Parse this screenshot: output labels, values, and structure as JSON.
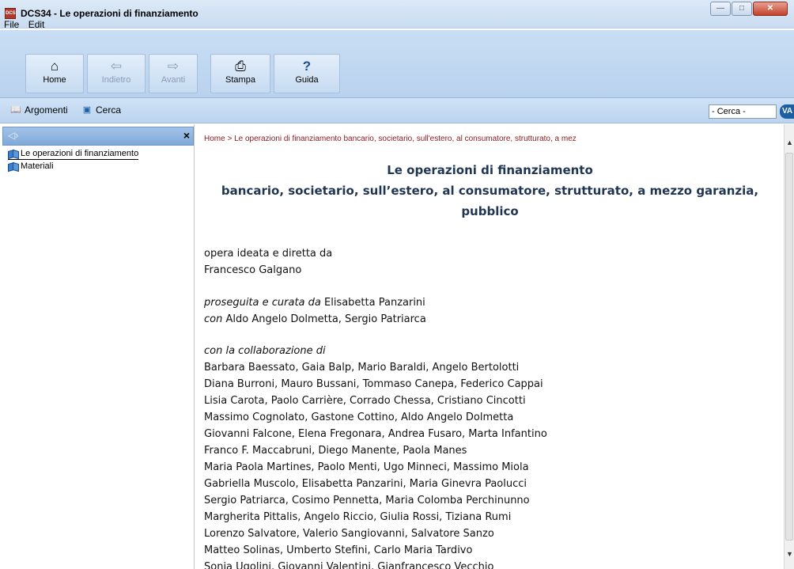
{
  "window": {
    "app_icon_text": "DCS",
    "title": "DCS34 - Le operazioni di finanziamento",
    "controls": [
      "minimize",
      "maximize",
      "close"
    ]
  },
  "menu": {
    "items": [
      "File",
      "Edit"
    ]
  },
  "toolbar": {
    "home": "Home",
    "back": "Indietro",
    "forward": "Avanti",
    "print": "Stampa",
    "help": "Guida"
  },
  "navbar": {
    "topics": "Argomenti",
    "search": "Cerca",
    "search_placeholder": "- Cerca -",
    "go": "VA"
  },
  "leftpane": {
    "tree": [
      {
        "label": "Le operazioni di finanziamento"
      },
      {
        "label": "Materiali"
      }
    ]
  },
  "content": {
    "breadcrumb": "Home > Le operazioni di finanziamento bancario, societario, sull'estero, al consumatore, strutturato, a mez",
    "title_line1": "Le operazioni di finanziamento",
    "title_line2": "bancario, societario, sull’estero, al consumatore, strutturato, a mezzo garanzia,",
    "title_line3": "pubblico",
    "intro_line1": "opera ideata e diretta da",
    "intro_line2": "Francesco Galgano",
    "continued_label": "proseguita e curata da",
    "continued_name": " Elisabetta Panzarini",
    "with_label": "con",
    "with_names": " Aldo Angelo Dolmetta, Sergio Patriarca",
    "collab_label": "con la collaborazione di",
    "collaborators": [
      "Barbara Baessato, Gaia Balp, Mario Baraldi, Angelo Bertolotti",
      "Diana Burroni, Mauro Bussani, Tommaso Canepa, Federico Cappai",
      "Lisia Carota, Paolo Carrière, Corrado Chessa, Cristiano Cincotti",
      "Massimo Cognolato, Gastone Cottino, Aldo Angelo Dolmetta",
      "Giovanni Falcone, Elena Fregonara, Andrea Fusaro, Marta Infantino",
      "Franco F. Maccabruni, Diego Manente, Paola Manes",
      "Maria Paola Martines, Paolo Menti, Ugo Minneci, Massimo Miola",
      "Gabriella Muscolo, Elisabetta Panzarini, Maria Ginevra Paolucci",
      "Sergio Patriarca, Cosimo Pennetta, Maria Colomba Perchinunno",
      "Margherita Pittalis, Angelo Riccio, Giulia Rossi, Tiziana Rumi",
      "Lorenzo Salvatore, Valerio Sangiovanni, Salvatore Sanzo",
      "Matteo Solinas, Umberto Stefini, Carlo Maria Tardivo",
      "Sonia Ugolini, Giovanni Valentini, Gianfrancesco Vecchio"
    ]
  },
  "colors": {
    "titlebar": "#c9dcf0",
    "toolbar": "#b9d2ee",
    "breadcrumb": "#8a1a1a",
    "title_text": "#1f3552",
    "close_button": "#c2412b",
    "va_button": "#1d5fa3"
  },
  "icons": {
    "home": "house-icon",
    "back": "arrow-left-icon",
    "forward": "arrow-right-icon",
    "print": "printer-icon",
    "help": "question-icon",
    "topics": "book-icon",
    "search": "speech-bubble-icon",
    "tree": "book-icon"
  }
}
